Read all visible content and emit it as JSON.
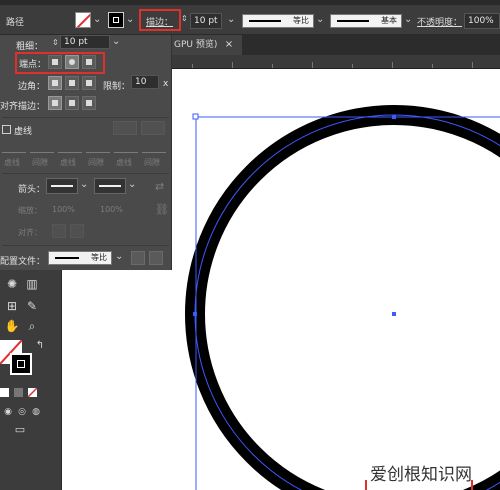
{
  "control_bar": {
    "object_type": "路径",
    "stroke_label": "描边：",
    "stroke_weight": "10 pt",
    "profile_label": "等比",
    "brush_label": "基本",
    "opacity_label": "不透明度：",
    "opacity_value": "100%"
  },
  "document_tab": {
    "title": "GPU 预览)",
    "close_glyph": "×"
  },
  "stroke_panel": {
    "weight_label": "粗细：",
    "weight_value": "10 pt",
    "cap_label": "端点：",
    "corner_label": "边角：",
    "limit_label": "限制：",
    "limit_value": "10",
    "limit_unit": "x",
    "align_label": "对齐描边：",
    "dashed_label": "虚线",
    "dash_labels": [
      "虚线",
      "间隙",
      "虚线",
      "间隙",
      "虚线",
      "间隙"
    ],
    "arrowheads_label": "箭头：",
    "scale_label": "缩放：",
    "scale_start": "100%",
    "scale_end": "100%",
    "align_arrow_label": "对齐：",
    "profile_label": "配置文件：",
    "profile_value": "等比"
  },
  "colors": {
    "highlight_red": "#e0302b",
    "selection_blue": "#3d5afe",
    "stroke_black": "#000000"
  },
  "watermark": "爱创根知识网"
}
